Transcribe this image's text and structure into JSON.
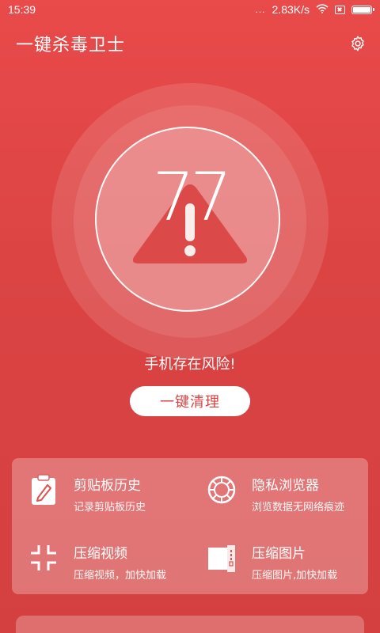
{
  "status_bar": {
    "time": "15:39",
    "signal_dots": "...",
    "net_speed": "2.83K/s",
    "wifi_icon": "wifi-icon",
    "battery_icon": "battery-icon"
  },
  "header": {
    "title": "一键杀毒卫士",
    "settings_icon": "gear-icon"
  },
  "gauge": {
    "score": "77",
    "warning_icon": "warning-triangle-icon"
  },
  "risk_text": "手机存在风险!",
  "clean_button": "一键清理",
  "tools": [
    {
      "title": "剪贴板历史",
      "desc": "记录剪贴板历史",
      "icon": "clipboard-edit-icon"
    },
    {
      "title": "隐私浏览器",
      "desc": "浏览数据无网络痕迹",
      "icon": "private-browser-icon"
    },
    {
      "title": "压缩视频",
      "desc": "压缩视频，加快加载",
      "icon": "compress-icon"
    },
    {
      "title": "压缩图片",
      "desc": "压缩图片,加快加载",
      "icon": "compress-file-icon"
    }
  ],
  "colors": {
    "background": "#dc4444",
    "button_text": "#d94444"
  }
}
